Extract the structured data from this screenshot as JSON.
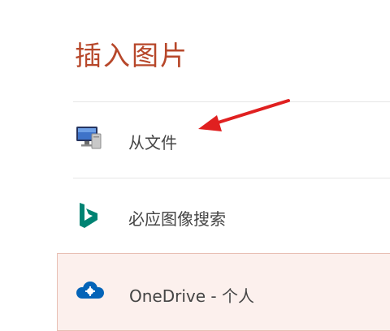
{
  "dialog": {
    "title": "插入图片",
    "options": [
      {
        "label": "从文件",
        "icon": "computer-icon"
      },
      {
        "label": "必应图像搜索",
        "icon": "bing-icon"
      },
      {
        "label": "OneDrive - 个人",
        "icon": "onedrive-icon"
      }
    ]
  },
  "colors": {
    "title": "#b7472a",
    "annotation_arrow": "#e02020",
    "bing": "#008373",
    "onedrive": "#0364b8"
  }
}
